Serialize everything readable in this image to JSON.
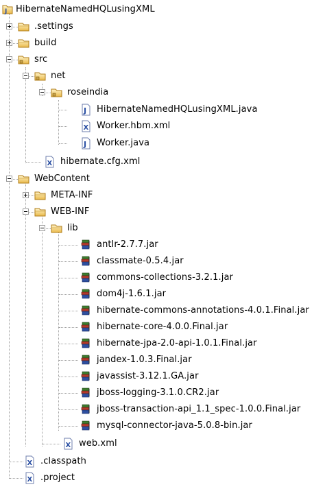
{
  "tree": {
    "project": "HibernateNamedHQLusingXML",
    "settings_folder": ".settings",
    "build_folder": "build",
    "src_folder": "src",
    "net_package": "net",
    "roseindia_package": "roseindia",
    "main_java": "HibernateNamedHQLusingXML.java",
    "worker_hbm": "Worker.hbm.xml",
    "worker_java": "Worker.java",
    "hibernate_cfg": "hibernate.cfg.xml",
    "webcontent_folder": "WebContent",
    "meta_inf_folder": "META-INF",
    "web_inf_folder": "WEB-INF",
    "lib_folder": "lib",
    "jars": [
      "antlr-2.7.7.jar",
      "classmate-0.5.4.jar",
      "commons-collections-3.2.1.jar",
      "dom4j-1.6.1.jar",
      "hibernate-commons-annotations-4.0.1.Final.jar",
      "hibernate-core-4.0.0.Final.jar",
      "hibernate-jpa-2.0-api-1.0.1.Final.jar",
      "jandex-1.0.3.Final.jar",
      "javassist-3.12.1.GA.jar",
      "jboss-logging-3.1.0.CR2.jar",
      "jboss-transaction-api_1.1_spec-1.0.0.Final.jar",
      "mysql-connector-java-5.0.8-bin.jar"
    ],
    "web_xml": "web.xml",
    "classpath_file": ".classpath",
    "project_file": ".project"
  }
}
